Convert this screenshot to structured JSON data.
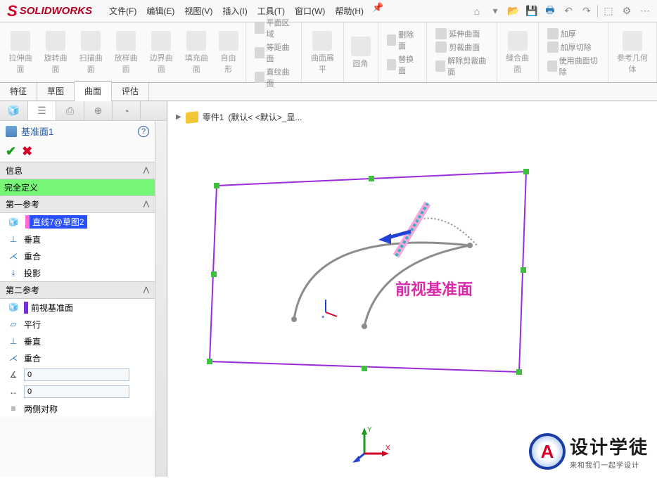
{
  "app": {
    "name": "SOLIDWORKS"
  },
  "menu": {
    "items": [
      "文件(F)",
      "编辑(E)",
      "视图(V)",
      "插入(I)",
      "工具(T)",
      "窗口(W)",
      "帮助(H)"
    ]
  },
  "ribbon": {
    "group1": [
      "拉伸曲面",
      "旋转曲面",
      "扫描曲面",
      "放样曲面",
      "边界曲面",
      "填充曲面",
      "自由形"
    ],
    "group2": [
      "平面区域",
      "等距曲面",
      "直纹曲面"
    ],
    "flat": "曲面展平",
    "fillet": "圆角",
    "group3": [
      "删除面",
      "替换面"
    ],
    "group4": [
      "延伸曲面",
      "剪裁曲面",
      "解除剪裁曲面"
    ],
    "sew": "缝合曲面",
    "group5": [
      "加厚",
      "加厚切除",
      "使用曲面切除"
    ],
    "ref": "参考几何体"
  },
  "tabs": [
    "特征",
    "草图",
    "曲面",
    "评估"
  ],
  "activeTab": "曲面",
  "breadcrumb": {
    "part": "零件1",
    "state": "(默认< <默认>_显..."
  },
  "prop": {
    "title": "基准面1",
    "info_hdr": "信息",
    "status": "完全定义",
    "ref1_hdr": "第一参考",
    "ref1_sel": "直线7@草图2",
    "perp": "垂直",
    "coinc": "重合",
    "proj": "投影",
    "ref2_hdr": "第二参考",
    "ref2_sel": "前视基准面",
    "parallel": "平行",
    "val0": "0",
    "sym": "两侧对称"
  },
  "plane_label": "前视基准面",
  "wm": {
    "main": "设计学徒",
    "sub": "来和我们一起学设计"
  }
}
